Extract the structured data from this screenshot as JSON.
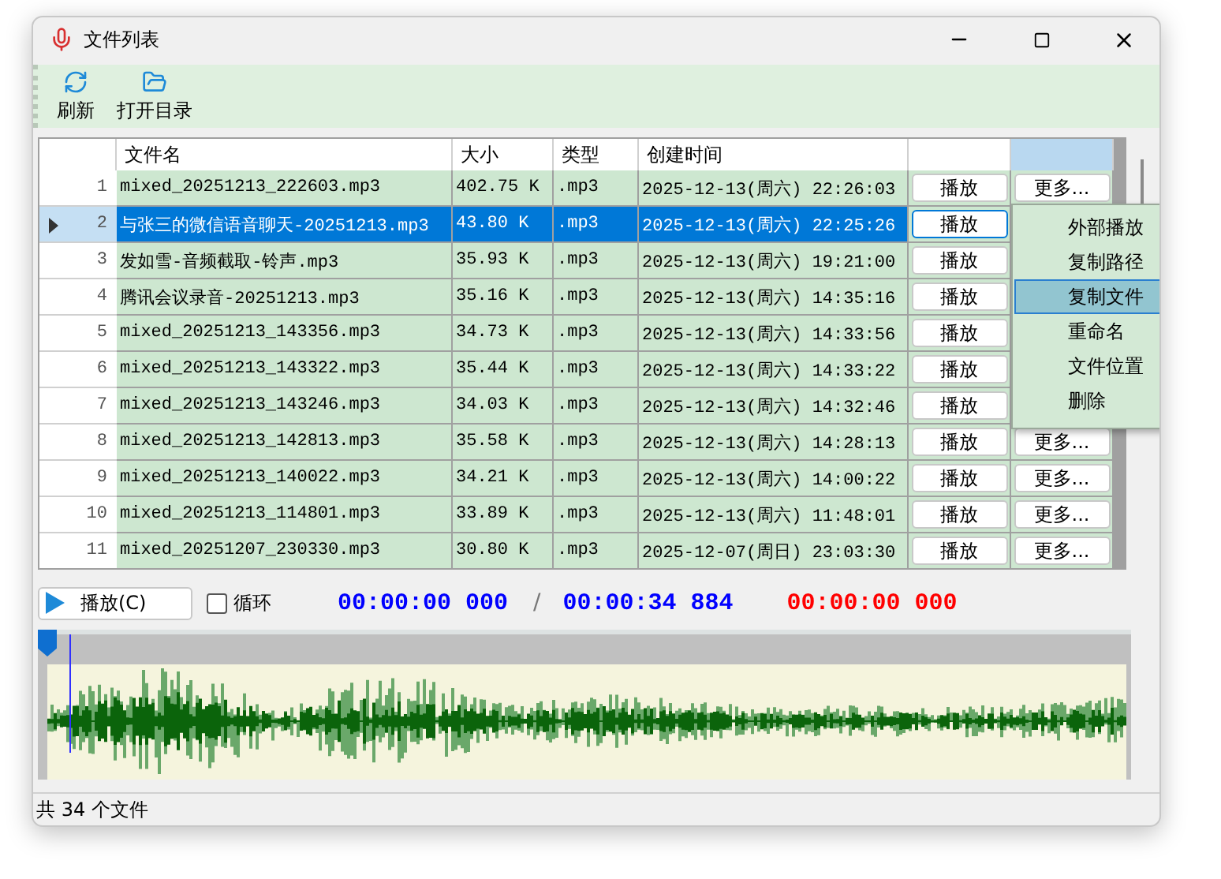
{
  "window": {
    "title": "文件列表"
  },
  "toolbar": [
    {
      "kind": "refresh",
      "label": "刷新"
    },
    {
      "kind": "folder",
      "label": "打开目录"
    }
  ],
  "table": {
    "columns": [
      {
        "kind": "text",
        "label": "文件名",
        "selected": false
      },
      {
        "kind": "text",
        "label": "大小",
        "selected": false
      },
      {
        "kind": "text",
        "label": "类型",
        "selected": false
      },
      {
        "kind": "text",
        "label": "创建时间",
        "selected": false
      },
      {
        "kind": "blank",
        "selected": false
      },
      {
        "kind": "blank",
        "selected": true
      }
    ],
    "rows": [
      {
        "index": "1",
        "name": "mixed_20251213_222603.mp3",
        "size": "402.75 K",
        "type": ".mp3",
        "created": "2025-12-13(周六) 22:26:03",
        "play": "播放",
        "more": "更多...",
        "selected": false
      },
      {
        "index": "2",
        "name": "与张三的微信语音聊天-20251213.mp3",
        "size": "43.80 K",
        "type": ".mp3",
        "created": "2025-12-13(周六) 22:25:26",
        "play": "播放",
        "selected": true
      },
      {
        "index": "3",
        "name": "发如雪-音频截取-铃声.mp3",
        "size": "35.93 K",
        "type": ".mp3",
        "created": "2025-12-13(周六) 19:21:00",
        "play": "播放",
        "selected": false
      },
      {
        "index": "4",
        "name": "腾讯会议录音-20251213.mp3",
        "size": "35.16 K",
        "type": ".mp3",
        "created": "2025-12-13(周六) 14:35:16",
        "play": "播放",
        "selected": false
      },
      {
        "index": "5",
        "name": "mixed_20251213_143356.mp3",
        "size": "34.73 K",
        "type": ".mp3",
        "created": "2025-12-13(周六) 14:33:56",
        "play": "播放",
        "selected": false
      },
      {
        "index": "6",
        "name": "mixed_20251213_143322.mp3",
        "size": "35.44 K",
        "type": ".mp3",
        "created": "2025-12-13(周六) 14:33:22",
        "play": "播放",
        "selected": false
      },
      {
        "index": "7",
        "name": "mixed_20251213_143246.mp3",
        "size": "34.03 K",
        "type": ".mp3",
        "created": "2025-12-13(周六) 14:32:46",
        "play": "播放",
        "selected": false
      },
      {
        "index": "8",
        "name": "mixed_20251213_142813.mp3",
        "size": "35.58 K",
        "type": ".mp3",
        "created": "2025-12-13(周六) 14:28:13",
        "play": "播放",
        "more": "更多...",
        "selected": false
      },
      {
        "index": "9",
        "name": "mixed_20251213_140022.mp3",
        "size": "34.21 K",
        "type": ".mp3",
        "created": "2025-12-13(周六) 14:00:22",
        "play": "播放",
        "more": "更多...",
        "selected": false
      },
      {
        "index": "10",
        "name": "mixed_20251213_114801.mp3",
        "size": "33.89 K",
        "type": ".mp3",
        "created": "2025-12-13(周六) 11:48:01",
        "play": "播放",
        "more": "更多...",
        "selected": false
      },
      {
        "index": "11",
        "name": "mixed_20251207_230330.mp3",
        "size": "30.80 K",
        "type": ".mp3",
        "created": "2025-12-07(周日) 23:03:30",
        "play": "播放",
        "more": "更多...",
        "selected": false
      }
    ]
  },
  "context_menu": {
    "items": [
      {
        "label": "外部播放",
        "selected": false
      },
      {
        "label": "复制路径",
        "selected": false
      },
      {
        "label": "复制文件",
        "selected": true
      },
      {
        "label": "重命名",
        "selected": false
      },
      {
        "label": "文件位置",
        "selected": false
      },
      {
        "label": "删除",
        "selected": false
      }
    ]
  },
  "player": {
    "play_label": "播放(C)",
    "loop": {
      "label": "循环",
      "checked": false
    },
    "current_time": "00:00:00 000",
    "separator": "/",
    "total_time": "00:00:34 884",
    "selection_time": "00:00:00 000",
    "level": 0
  },
  "status_bar": "共 34 个文件"
}
